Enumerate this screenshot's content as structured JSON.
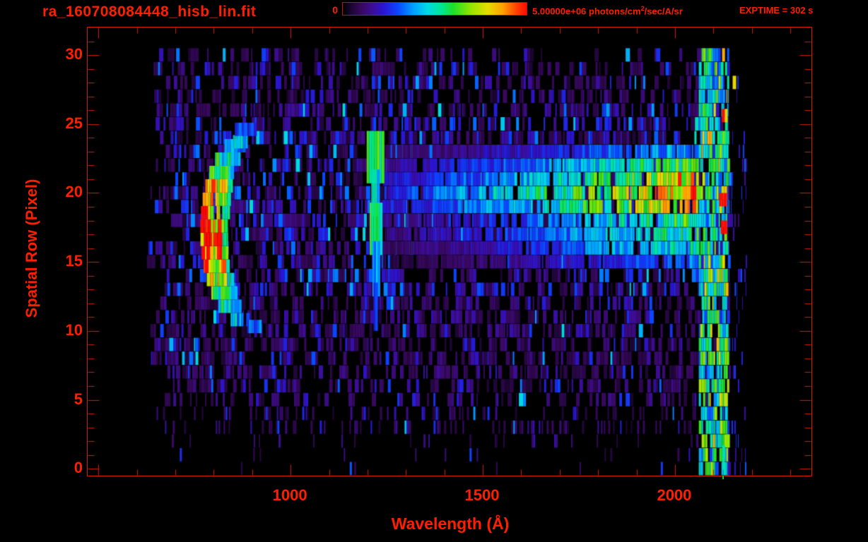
{
  "header": {
    "title": "ra_160708084448_hisb_lin.fit",
    "exptime_label": "EXPTIME = 302 s"
  },
  "colors": {
    "text_red": "#ff1e00",
    "axis_red": "#d41e00",
    "background": "#000000",
    "below_axis_artifact": "#22c822"
  },
  "chart_data": {
    "type": "heatmap",
    "title": "ra_160708084448_hisb_lin.fit",
    "xlabel": "Wavelength (Å)",
    "ylabel": "Spatial Row (Pixel)",
    "xlim": [
      472,
      2355
    ],
    "ylim": [
      -0.5,
      32
    ],
    "x_axis": {
      "major_ticks": [
        {
          "value": 1000,
          "label": "1000"
        },
        {
          "value": 1500,
          "label": "1500"
        },
        {
          "value": 2000,
          "label": "2000"
        }
      ],
      "minor_step": 100,
      "minor_range": [
        500,
        2300
      ]
    },
    "y_axis": {
      "major_ticks": [
        {
          "value": 0,
          "label": "0"
        },
        {
          "value": 5,
          "label": "5"
        },
        {
          "value": 10,
          "label": "10"
        },
        {
          "value": 15,
          "label": "15"
        },
        {
          "value": 20,
          "label": "20"
        },
        {
          "value": 25,
          "label": "25"
        },
        {
          "value": 30,
          "label": "30"
        }
      ],
      "minor_step": 1,
      "minor_range": [
        0,
        31
      ]
    },
    "colorbar": {
      "min": 0,
      "max": 5000000,
      "min_label": "0",
      "max_label_value": "5.00000e+06 ",
      "units_prefix": "photons/cm",
      "units_sup": "2",
      "units_suffix": "/sec/A/sr",
      "stops": [
        [
          0,
          "#000000"
        ],
        [
          0.05,
          "#1e0636"
        ],
        [
          0.1,
          "#38085e"
        ],
        [
          0.16,
          "#3c0d96"
        ],
        [
          0.22,
          "#2a14d2"
        ],
        [
          0.3,
          "#0a46ff"
        ],
        [
          0.38,
          "#009cff"
        ],
        [
          0.46,
          "#00d8e6"
        ],
        [
          0.54,
          "#00e691"
        ],
        [
          0.6,
          "#1ee028"
        ],
        [
          0.7,
          "#96e600"
        ],
        [
          0.79,
          "#e6dc00"
        ],
        [
          0.87,
          "#ffa000"
        ],
        [
          0.94,
          "#ff4600"
        ],
        [
          1,
          "#ff0a00"
        ]
      ]
    },
    "exptime": {
      "label": "EXPTIME = 302 s",
      "seconds": 302
    },
    "n_rows": 31,
    "wavelength_coverage": [
      660,
      2140
    ],
    "noise": {
      "lam_start": 660,
      "lam_end": 2140,
      "start_jitter": 42,
      "row_activity": [
        0.04,
        0.05,
        0.1,
        0.3,
        0.38,
        0.55,
        0.72,
        0.78,
        0.8,
        0.8,
        0.82,
        0.85,
        0.85,
        0.88,
        0.88,
        0.88,
        0.9,
        0.9,
        0.9,
        0.9,
        0.9,
        0.9,
        0.9,
        0.88,
        0.85,
        0.82,
        0.8,
        0.75,
        0.72,
        0.7,
        0.45
      ],
      "blue_rows": [
        13,
        14,
        15,
        16,
        17,
        18,
        19,
        20,
        21,
        22,
        23,
        24,
        25,
        26
      ]
    },
    "features": {
      "crescent": {
        "lam_center": 877,
        "row_center": 17.3,
        "lam_radius": 112,
        "row_radius": 6.8,
        "thickness_lam": 70,
        "peak_value": 0.88,
        "rows": [
          10.8,
          24.0
        ]
      },
      "crescent_extras": [
        {
          "row": 23.7,
          "lam0": 850,
          "lam1": 888,
          "v": 0.45
        },
        {
          "row": 24.6,
          "lam0": 855,
          "lam1": 912,
          "v": 0.28
        },
        {
          "row": 10.3,
          "lam0": 888,
          "lam1": 924,
          "v": 0.33
        }
      ],
      "lyman_alpha": {
        "lam": 1220,
        "segments": [
          {
            "row0": 21.2,
            "row1": 24.0,
            "halfw_lam": 22,
            "v": 0.62
          },
          {
            "row0": 18.8,
            "row1": 21.2,
            "halfw_lam": 10,
            "v": 0.45
          },
          {
            "row0": 16.0,
            "row1": 18.8,
            "halfw_lam": 14,
            "v": 0.58
          },
          {
            "row0": 13.0,
            "row1": 16.0,
            "halfw_lam": 7,
            "v": 0.4
          },
          {
            "row0": 10.5,
            "row1": 13.0,
            "halfw_lam": 4,
            "v": 0.25
          }
        ]
      },
      "trace": {
        "lam0": 1240,
        "lam1": 2060,
        "rows": [
          {
            "row": 23,
            "v0": 0.1,
            "v1": 0.42
          },
          {
            "row": 22,
            "v0": 0.16,
            "v1": 0.62
          },
          {
            "row": 21,
            "v0": 0.2,
            "v1": 0.78
          },
          {
            "row": 20,
            "v0": 0.26,
            "v1": 0.88
          },
          {
            "row": 19,
            "v0": 0.22,
            "v1": 0.82
          },
          {
            "row": 18,
            "v0": 0.14,
            "v1": 0.6
          },
          {
            "row": 17,
            "v0": 0.14,
            "v1": 0.56
          },
          {
            "row": 16,
            "v0": 0.1,
            "v1": 0.5
          },
          {
            "row": 15,
            "v0": 0.06,
            "v1": 0.34
          }
        ]
      },
      "edge_column": {
        "lam0": 2062,
        "lam1": 2136,
        "fill": 0.8,
        "vmin": 0.32,
        "vmax": 0.66,
        "sparse_lam1": 2185,
        "sparse_fill": 0.12
      },
      "hotspots": [
        {
          "row": 20,
          "lam0": 1995,
          "lam1": 2058,
          "v": 0.86
        },
        {
          "row": 21,
          "lam0": 2002,
          "lam1": 2048,
          "v": 0.8
        },
        {
          "row": 19.5,
          "lam0": 2115,
          "lam1": 2129,
          "v": 0.97
        },
        {
          "row": 17.5,
          "lam0": 2119,
          "lam1": 2127,
          "v": 0.96
        },
        {
          "row": 28,
          "lam0": 2150,
          "lam1": 2158,
          "v": 0.94
        },
        {
          "row": 25.6,
          "lam0": 2122,
          "lam1": 2130,
          "v": 0.84
        },
        {
          "row": 5,
          "lam0": 2128,
          "lam1": 2135,
          "v": 0.84
        },
        {
          "row": 2,
          "lam0": 2128,
          "lam1": 2136,
          "v": 0.88
        },
        {
          "row": 1.2,
          "lam0": 2123,
          "lam1": 2127,
          "v": 0.58
        },
        {
          "row": 0.4,
          "lam0": 2123,
          "lam1": 2127,
          "v": 0.55
        }
      ]
    }
  }
}
